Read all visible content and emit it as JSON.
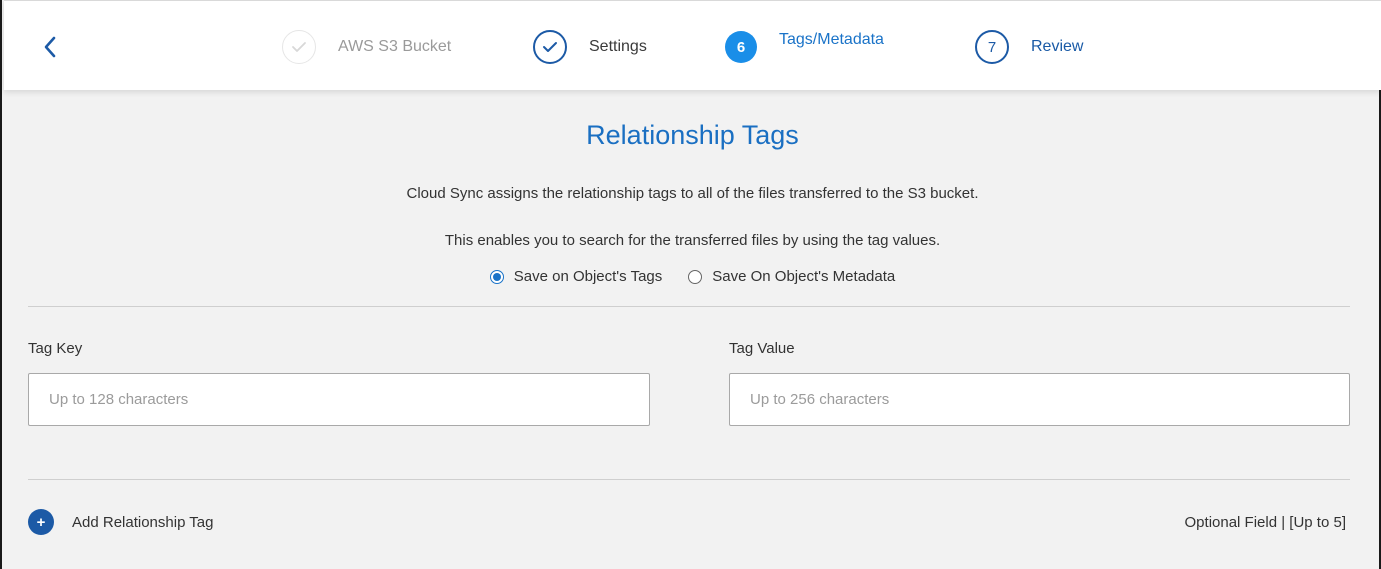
{
  "wizard": {
    "back_icon": "chevron-left-icon",
    "steps": [
      {
        "label": "AWS S3 Bucket",
        "marker": "",
        "icon": "check-icon",
        "state": "completed-faded"
      },
      {
        "label": "Settings",
        "marker": "",
        "icon": "check-icon",
        "state": "completed"
      },
      {
        "label": "Tags/Metadata",
        "marker": "6",
        "icon": "",
        "state": "active"
      },
      {
        "label": "Review",
        "marker": "7",
        "icon": "",
        "state": "upcoming"
      }
    ]
  },
  "main": {
    "title": "Relationship Tags",
    "description_line1": "Cloud Sync assigns the relationship tags to all of the files transferred to the S3 bucket.",
    "description_line2": "This enables you to search for the transferred files by using the tag values.",
    "radio_options": [
      {
        "label": "Save on Object's Tags",
        "checked": true
      },
      {
        "label": "Save On Object's Metadata",
        "checked": false
      }
    ],
    "tag_key": {
      "label": "Tag Key",
      "placeholder": "Up to 128 characters",
      "value": ""
    },
    "tag_value": {
      "label": "Tag Value",
      "placeholder": "Up to 256 characters",
      "value": ""
    },
    "add_button": {
      "label": "Add Relationship Tag",
      "icon": "plus-icon"
    },
    "optional_note": "Optional Field | [Up to 5]"
  },
  "colors": {
    "accent": "#1a73c8",
    "active_step": "#1a8ee8",
    "dark_blue": "#1c5aa6",
    "background": "#f2f2f2"
  }
}
